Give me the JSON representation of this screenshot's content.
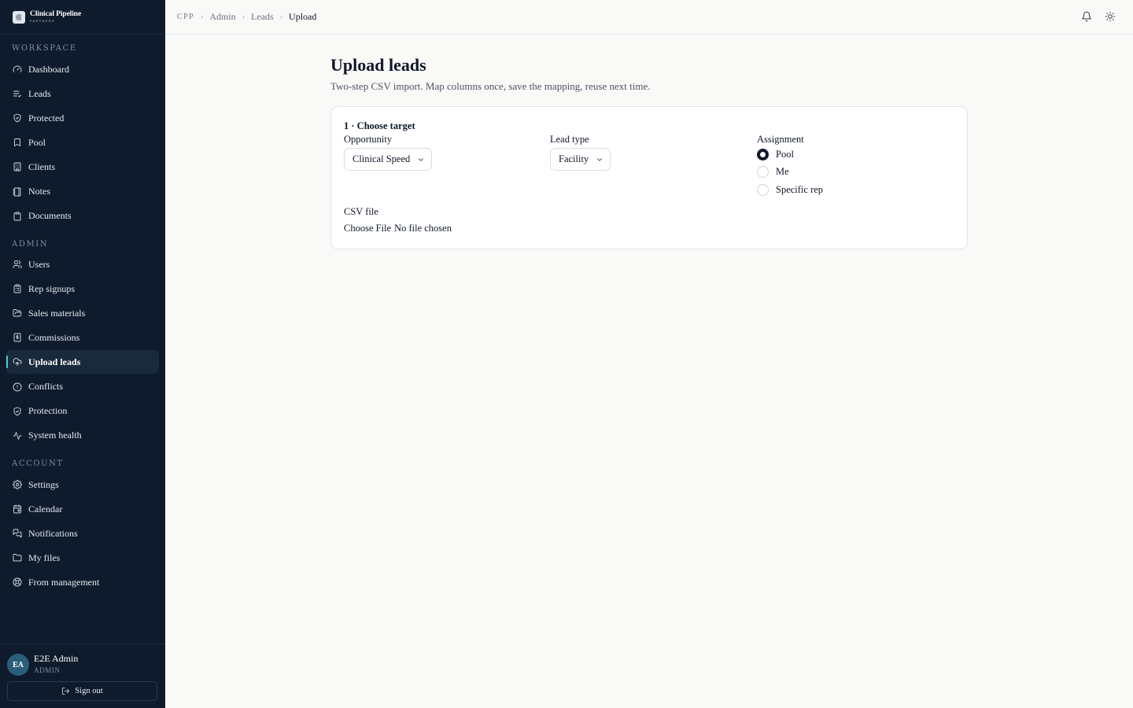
{
  "brand": {
    "name": "Clinical Pipeline",
    "sub": "PARTNERS"
  },
  "sidebar": {
    "workspace_label": "WORKSPACE",
    "admin_label": "ADMIN",
    "account_label": "ACCOUNT",
    "workspace": [
      {
        "label": "Dashboard",
        "icon": "gauge-icon"
      },
      {
        "label": "Leads",
        "icon": "list-check-icon"
      },
      {
        "label": "Protected",
        "icon": "shield-check-icon"
      },
      {
        "label": "Pool",
        "icon": "bookmark-icon"
      },
      {
        "label": "Clients",
        "icon": "building-icon"
      },
      {
        "label": "Notes",
        "icon": "notebook-icon"
      },
      {
        "label": "Documents",
        "icon": "clipboard-icon"
      }
    ],
    "admin": [
      {
        "label": "Users",
        "icon": "users-icon"
      },
      {
        "label": "Rep signups",
        "icon": "clipboard-list-icon"
      },
      {
        "label": "Sales materials",
        "icon": "folder-open-icon"
      },
      {
        "label": "Commissions",
        "icon": "dollar-receipt-icon"
      },
      {
        "label": "Upload leads",
        "icon": "cloud-upload-icon",
        "active": true
      },
      {
        "label": "Conflicts",
        "icon": "alert-circle-icon"
      },
      {
        "label": "Protection",
        "icon": "shield-icon"
      },
      {
        "label": "System health",
        "icon": "activity-icon"
      }
    ],
    "account": [
      {
        "label": "Settings",
        "icon": "gear-icon"
      },
      {
        "label": "Calendar",
        "icon": "calendar-icon"
      },
      {
        "label": "Notifications",
        "icon": "messages-icon"
      },
      {
        "label": "My files",
        "icon": "folder-icon"
      },
      {
        "label": "From management",
        "icon": "lifebuoy-icon"
      }
    ]
  },
  "user": {
    "initials": "EA",
    "name": "E2E Admin",
    "role": "ADMIN",
    "signout_label": "Sign out"
  },
  "breadcrumb": {
    "root": "CPP",
    "admin": "Admin",
    "leads": "Leads",
    "current": "Upload"
  },
  "page": {
    "title": "Upload leads",
    "subtitle": "Two-step CSV import. Map columns once, save the mapping, reuse next time."
  },
  "form": {
    "step_title": "1 · Choose target",
    "opportunity_label": "Opportunity",
    "opportunity_value": "Clinical Speed",
    "lead_type_label": "Lead type",
    "lead_type_value": "Facility",
    "assignment_label": "Assignment",
    "assignment_options": [
      {
        "label": "Pool",
        "checked": true
      },
      {
        "label": "Me",
        "checked": false
      },
      {
        "label": "Specific rep",
        "checked": false
      }
    ],
    "csv_label": "CSV file",
    "file_button": "Choose File",
    "file_status": "No file chosen"
  }
}
